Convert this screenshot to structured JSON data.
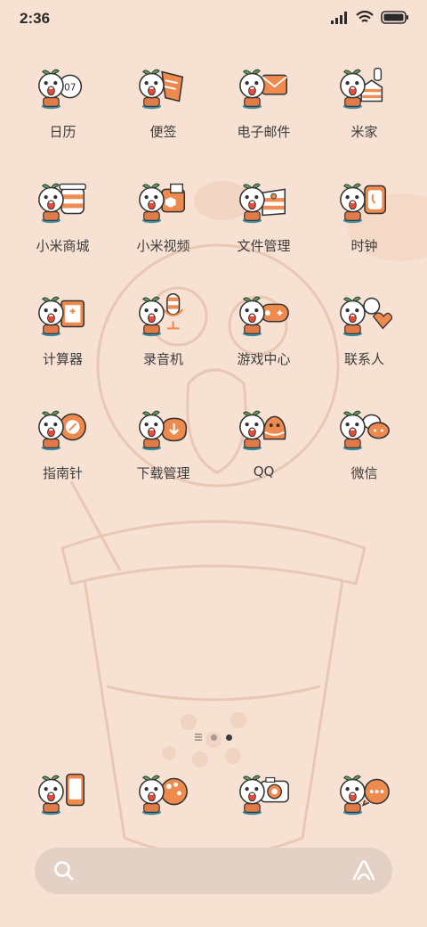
{
  "status_bar": {
    "time": "2:36"
  },
  "apps": [
    {
      "label": "日历",
      "icon": "calendar-icon",
      "text": "07"
    },
    {
      "label": "便签",
      "icon": "notes-icon"
    },
    {
      "label": "电子邮件",
      "icon": "email-icon"
    },
    {
      "label": "米家",
      "icon": "mi-home-icon"
    },
    {
      "label": "小米商城",
      "icon": "mi-store-icon"
    },
    {
      "label": "小米视频",
      "icon": "mi-video-icon"
    },
    {
      "label": "文件管理",
      "icon": "file-manager-icon"
    },
    {
      "label": "时钟",
      "icon": "clock-icon"
    },
    {
      "label": "计算器",
      "icon": "calculator-icon"
    },
    {
      "label": "录音机",
      "icon": "recorder-icon"
    },
    {
      "label": "游戏中心",
      "icon": "game-center-icon"
    },
    {
      "label": "联系人",
      "icon": "contacts-icon"
    },
    {
      "label": "指南针",
      "icon": "compass-icon"
    },
    {
      "label": "下载管理",
      "icon": "downloads-icon"
    },
    {
      "label": "QQ",
      "icon": "qq-icon"
    },
    {
      "label": "微信",
      "icon": "wechat-icon"
    }
  ],
  "dock": [
    {
      "icon": "phone-icon"
    },
    {
      "icon": "browser-icon"
    },
    {
      "icon": "camera-icon"
    },
    {
      "icon": "messages-icon"
    }
  ],
  "page_indicator": {
    "pages": 3,
    "active_index": 2
  },
  "colors": {
    "background": "#f7e1d3",
    "accent": "#ee8a4e",
    "search_bar": "#e4d1c6"
  }
}
